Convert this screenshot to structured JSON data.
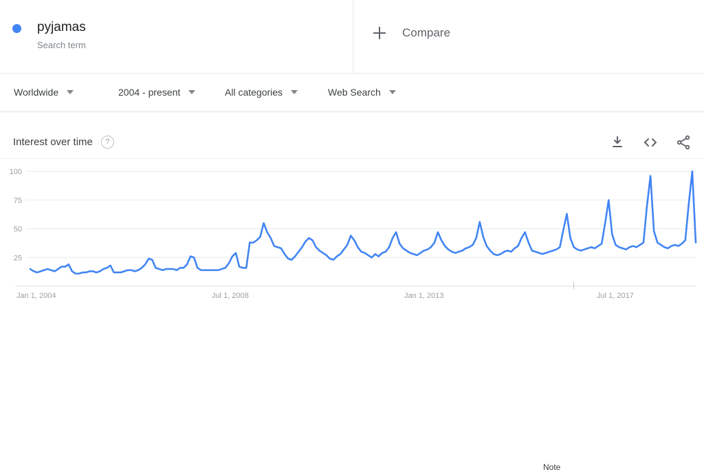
{
  "legend": {
    "term": "pyjamas",
    "subtitle": "Search term",
    "dot_color": "#4285f4"
  },
  "compare": {
    "label": "Compare",
    "icon": "plus-icon"
  },
  "filters": [
    {
      "label": "Worldwide",
      "icon": "chevron-down-icon"
    },
    {
      "label": "2004 - present",
      "icon": "chevron-down-icon"
    },
    {
      "label": "All categories",
      "icon": "chevron-down-icon"
    },
    {
      "label": "Web Search",
      "icon": "chevron-down-icon"
    }
  ],
  "card": {
    "title": "Interest over time",
    "help_icon_glyph": "?",
    "actions": [
      {
        "name": "download-icon"
      },
      {
        "name": "embed-icon"
      },
      {
        "name": "share-icon"
      }
    ]
  },
  "annotation": {
    "note_label": "Note"
  },
  "chart_data": {
    "type": "line",
    "title": "Interest over time",
    "series_name": "pyjamas",
    "line_color": "#4285f4",
    "xlabel": "",
    "ylabel": "",
    "ylim": [
      0,
      100
    ],
    "yticks": [
      25,
      50,
      75,
      100
    ],
    "grid": true,
    "legend_position": "top",
    "xticks": [
      "Jan 1, 2004",
      "Jul 1, 2008",
      "Jan 1, 2013",
      "Jul 1, 2017"
    ],
    "xtick_index": [
      0,
      54,
      108,
      162
    ],
    "x_start": "2004-01",
    "x_end": "2019-04",
    "x_frequency": "monthly",
    "values": [
      15,
      13,
      12,
      13,
      14,
      15,
      14,
      13,
      15,
      17,
      17,
      19,
      13,
      11,
      11,
      12,
      12,
      13,
      13,
      12,
      13,
      15,
      16,
      18,
      12,
      12,
      12,
      13,
      14,
      14,
      13,
      14,
      16,
      19,
      24,
      23,
      16,
      15,
      14,
      15,
      15,
      15,
      14,
      16,
      16,
      19,
      26,
      25,
      16,
      14,
      14,
      14,
      14,
      14,
      14,
      15,
      16,
      20,
      26,
      29,
      17,
      16,
      16,
      38,
      38,
      40,
      43,
      55,
      47,
      42,
      35,
      34,
      33,
      28,
      24,
      23,
      26,
      30,
      34,
      39,
      42,
      40,
      34,
      31,
      29,
      27,
      24,
      23,
      26,
      28,
      32,
      36,
      44,
      40,
      34,
      30,
      29,
      27,
      25,
      28,
      26,
      29,
      30,
      34,
      42,
      47,
      37,
      33,
      31,
      29,
      28,
      27,
      29,
      31,
      32,
      34,
      38,
      47,
      40,
      35,
      32,
      30,
      29,
      30,
      31,
      33,
      34,
      36,
      42,
      56,
      43,
      35,
      31,
      28,
      27,
      28,
      30,
      31,
      30,
      33,
      35,
      42,
      47,
      38,
      31,
      30,
      29,
      28,
      29,
      30,
      31,
      32,
      34,
      49,
      63,
      42,
      34,
      32,
      31,
      32,
      33,
      34,
      33,
      35,
      37,
      55,
      75,
      45,
      36,
      34,
      33,
      32,
      34,
      35,
      34,
      36,
      38,
      70,
      96,
      48,
      38,
      36,
      34,
      33,
      35,
      36,
      35,
      37,
      40,
      72,
      100,
      38
    ]
  }
}
